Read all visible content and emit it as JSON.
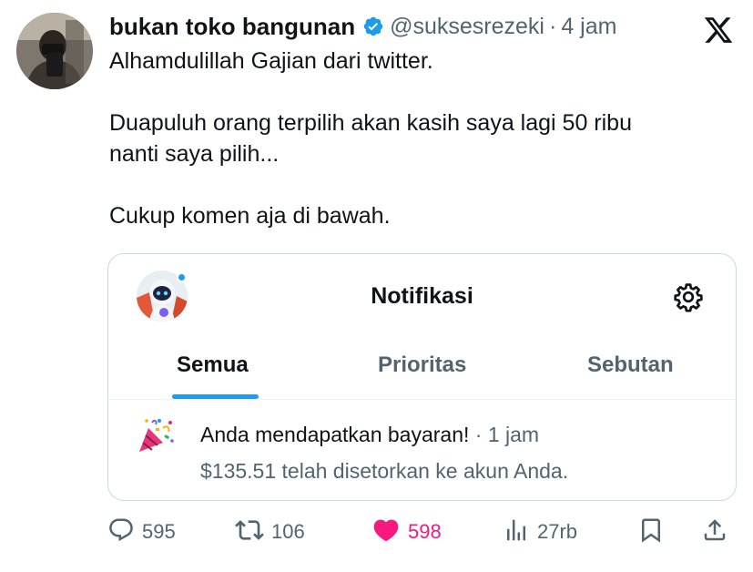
{
  "tweet": {
    "author_name": "bukan toko bangunan",
    "handle": "@suksesrezeki",
    "separator": "·",
    "time": "4 jam",
    "lines": [
      "Alhamdulillah Gajian dari twitter.",
      "Duapuluh orang terpilih akan kasih saya lagi 50 ribu",
      "nanti saya pilih...",
      "Cukup komen aja di bawah."
    ]
  },
  "icons": {
    "verified": "verified-badge-icon",
    "x_logo": "x-logo-icon",
    "gear": "gear-icon",
    "party": "party-popper-icon",
    "reply": "reply-icon",
    "retweet": "retweet-icon",
    "like": "heart-icon",
    "views": "views-icon",
    "bookmark": "bookmark-icon",
    "share": "share-icon"
  },
  "card": {
    "title": "Notifikasi",
    "tabs": [
      {
        "label": "Semua",
        "active": true
      },
      {
        "label": "Prioritas",
        "active": false
      },
      {
        "label": "Sebutan",
        "active": false
      }
    ],
    "notification": {
      "title": "Anda mendapatkan bayaran!",
      "separator": "·",
      "time": "1 jam",
      "body": "$135.51 telah disetorkan ke akun Anda."
    }
  },
  "actions": {
    "replies": "595",
    "retweets": "106",
    "likes": "598",
    "views": "27rb"
  },
  "colors": {
    "accent": "#1d9bf0",
    "like": "#f91880",
    "text": "#0f1419",
    "muted": "#536471",
    "border": "#cfd9de"
  }
}
